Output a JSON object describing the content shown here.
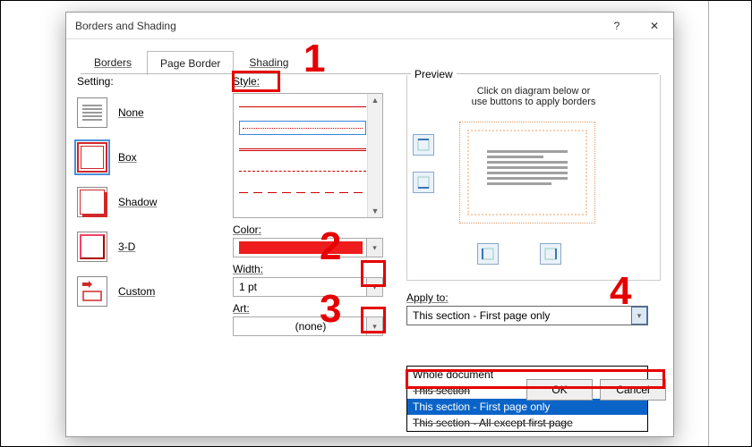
{
  "dialog": {
    "title": "Borders and Shading",
    "tabs": [
      "Borders",
      "Page Border",
      "Shading"
    ],
    "active_tab": 1,
    "ok": "OK",
    "cancel": "Cancel"
  },
  "setting": {
    "label": "Setting:",
    "items": [
      {
        "label": "None"
      },
      {
        "label": "Box"
      },
      {
        "label": "Shadow"
      },
      {
        "label": "3-D"
      },
      {
        "label": "Custom"
      }
    ],
    "selected_index": 1
  },
  "style": {
    "label": "Style:",
    "selected_index": 1
  },
  "color": {
    "label": "Color:",
    "value_hex": "#ee1c1c"
  },
  "width": {
    "label": "Width:",
    "value": "1 pt"
  },
  "art": {
    "label": "Art:",
    "value": "(none)"
  },
  "preview": {
    "label": "Preview",
    "hint1": "Click on diagram below or",
    "hint2": "use buttons to apply borders"
  },
  "apply": {
    "label": "Apply to:",
    "value": "This section - First page only",
    "options": [
      "Whole document",
      "This section",
      "This section - First page only",
      "This section - All except first page"
    ],
    "highlighted_index": 2
  },
  "callouts": {
    "1": "1",
    "2": "2",
    "3": "3",
    "4": "4"
  }
}
